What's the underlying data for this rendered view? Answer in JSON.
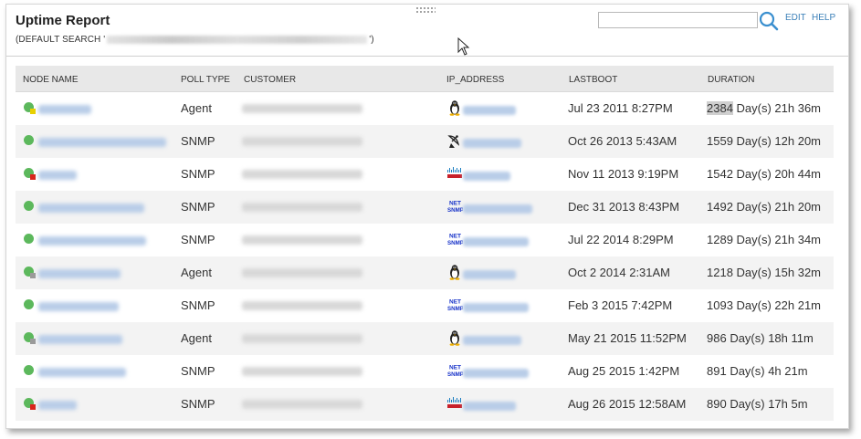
{
  "header": {
    "title": "Uptime Report",
    "subtitle_prefix": "(DEFAULT SEARCH '",
    "subtitle_suffix": "')",
    "edit_label": "EDIT",
    "help_label": "HELP",
    "search_placeholder": ""
  },
  "columns": {
    "node_name": "NODE NAME",
    "poll_type": "POLL TYPE",
    "customer": "CUSTOMER",
    "ip_address": "IP_ADDRESS",
    "lastboot": "LASTBOOT",
    "duration": "DURATION"
  },
  "rows": [
    {
      "poll": "Agent",
      "os_icon": "linux-icon",
      "status_badge": "warning",
      "lastboot": "Jul 23 2011 8:27PM",
      "duration_days": "2384",
      "duration_rest": " Day(s) 21h 36m"
    },
    {
      "poll": "SNMP",
      "os_icon": "satellite-dish-icon",
      "status_badge": "none",
      "lastboot": "Oct 26 2013 5:43AM",
      "duration_days": "1559",
      "duration_rest": " Day(s) 12h 20m"
    },
    {
      "poll": "SNMP",
      "os_icon": "cisco-icon",
      "status_badge": "critical",
      "lastboot": "Nov 11 2013 9:19PM",
      "duration_days": "1542",
      "duration_rest": " Day(s) 20h 44m"
    },
    {
      "poll": "SNMP",
      "os_icon": "net-snmp-icon",
      "status_badge": "none",
      "lastboot": "Dec 31 2013 8:43PM",
      "duration_days": "1492",
      "duration_rest": " Day(s) 21h 20m"
    },
    {
      "poll": "SNMP",
      "os_icon": "net-snmp-icon",
      "status_badge": "none",
      "lastboot": "Jul 22 2014 8:29PM",
      "duration_days": "1289",
      "duration_rest": " Day(s) 21h 34m"
    },
    {
      "poll": "Agent",
      "os_icon": "linux-icon",
      "status_badge": "unknown",
      "lastboot": "Oct 2 2014 2:31AM",
      "duration_days": "1218",
      "duration_rest": " Day(s) 15h 32m"
    },
    {
      "poll": "SNMP",
      "os_icon": "net-snmp-icon",
      "status_badge": "none",
      "lastboot": "Feb 3 2015 7:42PM",
      "duration_days": "1093",
      "duration_rest": " Day(s) 22h 21m"
    },
    {
      "poll": "Agent",
      "os_icon": "linux-icon",
      "status_badge": "unknown",
      "lastboot": "May 21 2015 11:52PM",
      "duration_days": "986",
      "duration_rest": " Day(s) 18h 11m"
    },
    {
      "poll": "SNMP",
      "os_icon": "net-snmp-icon",
      "status_badge": "none",
      "lastboot": "Aug 25 2015 1:42PM",
      "duration_days": "891",
      "duration_rest": " Day(s) 4h 21m"
    },
    {
      "poll": "SNMP",
      "os_icon": "cisco-icon",
      "status_badge": "critical",
      "lastboot": "Aug 26 2015 12:58AM",
      "duration_days": "890",
      "duration_rest": " Day(s) 17h 5m"
    }
  ],
  "colors": {
    "link": "#3a7fb8",
    "status_up": "#5cb85c",
    "badge_warning": "#e8d000",
    "badge_critical": "#d9241c",
    "badge_unknown": "#9a9a9a"
  }
}
